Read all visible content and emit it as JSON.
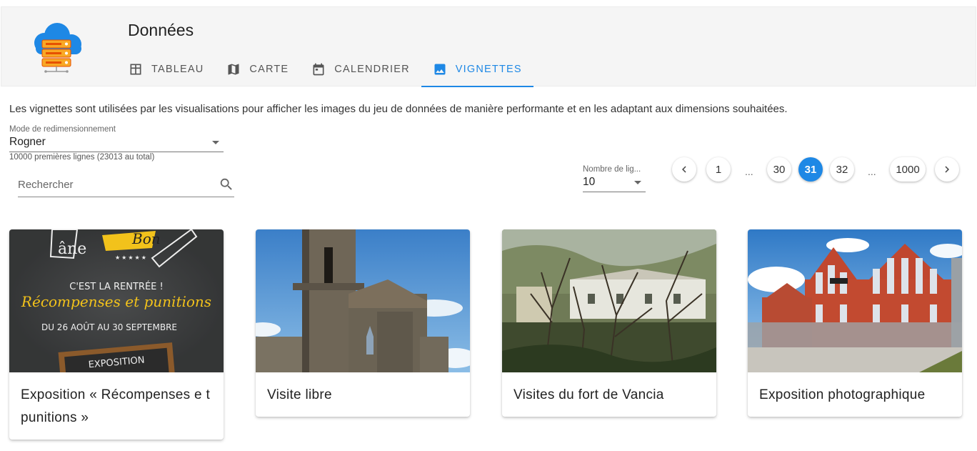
{
  "app": {
    "title": "Données",
    "logo_icon": "cloud-server-icon"
  },
  "tabs": [
    {
      "label": "TABLEAU",
      "icon": "table-icon"
    },
    {
      "label": "CARTE",
      "icon": "map-icon"
    },
    {
      "label": "CALENDRIER",
      "icon": "calendar-icon"
    },
    {
      "label": "VIGNETTES",
      "icon": "image-icon",
      "active": true
    }
  ],
  "description": "Les vignettes sont utilisées par les visualisations pour afficher les images du jeu de données de manière performante et en les adaptant aux dimensions souhaitées.",
  "resize_mode": {
    "label": "Mode de redimensionnement",
    "value": "Rogner"
  },
  "rows_info": "10000 premières lignes (23013 au total)",
  "search": {
    "placeholder": "Rechercher"
  },
  "rows_per_page": {
    "label": "Nombre de lig...",
    "value": "10"
  },
  "pagination": {
    "pages": [
      "1",
      "...",
      "30",
      "31",
      "32",
      "...",
      "1000"
    ],
    "current": "31"
  },
  "cards": [
    {
      "title": "Exposition « Récompenses e t punitions »",
      "thumb_text": [
        "C'EST LA RENTRÉE !",
        "Récompenses et punitions",
        "DU 26 AOÛT AU 30 SEPTEMBRE",
        "EXPOSITION"
      ]
    },
    {
      "title": "Visite libre"
    },
    {
      "title": "Visites du fort de Vancia"
    },
    {
      "title": "Exposition photographique"
    }
  ],
  "colors": {
    "accent": "#1e88e5",
    "header_bg": "#f5f5f5"
  }
}
